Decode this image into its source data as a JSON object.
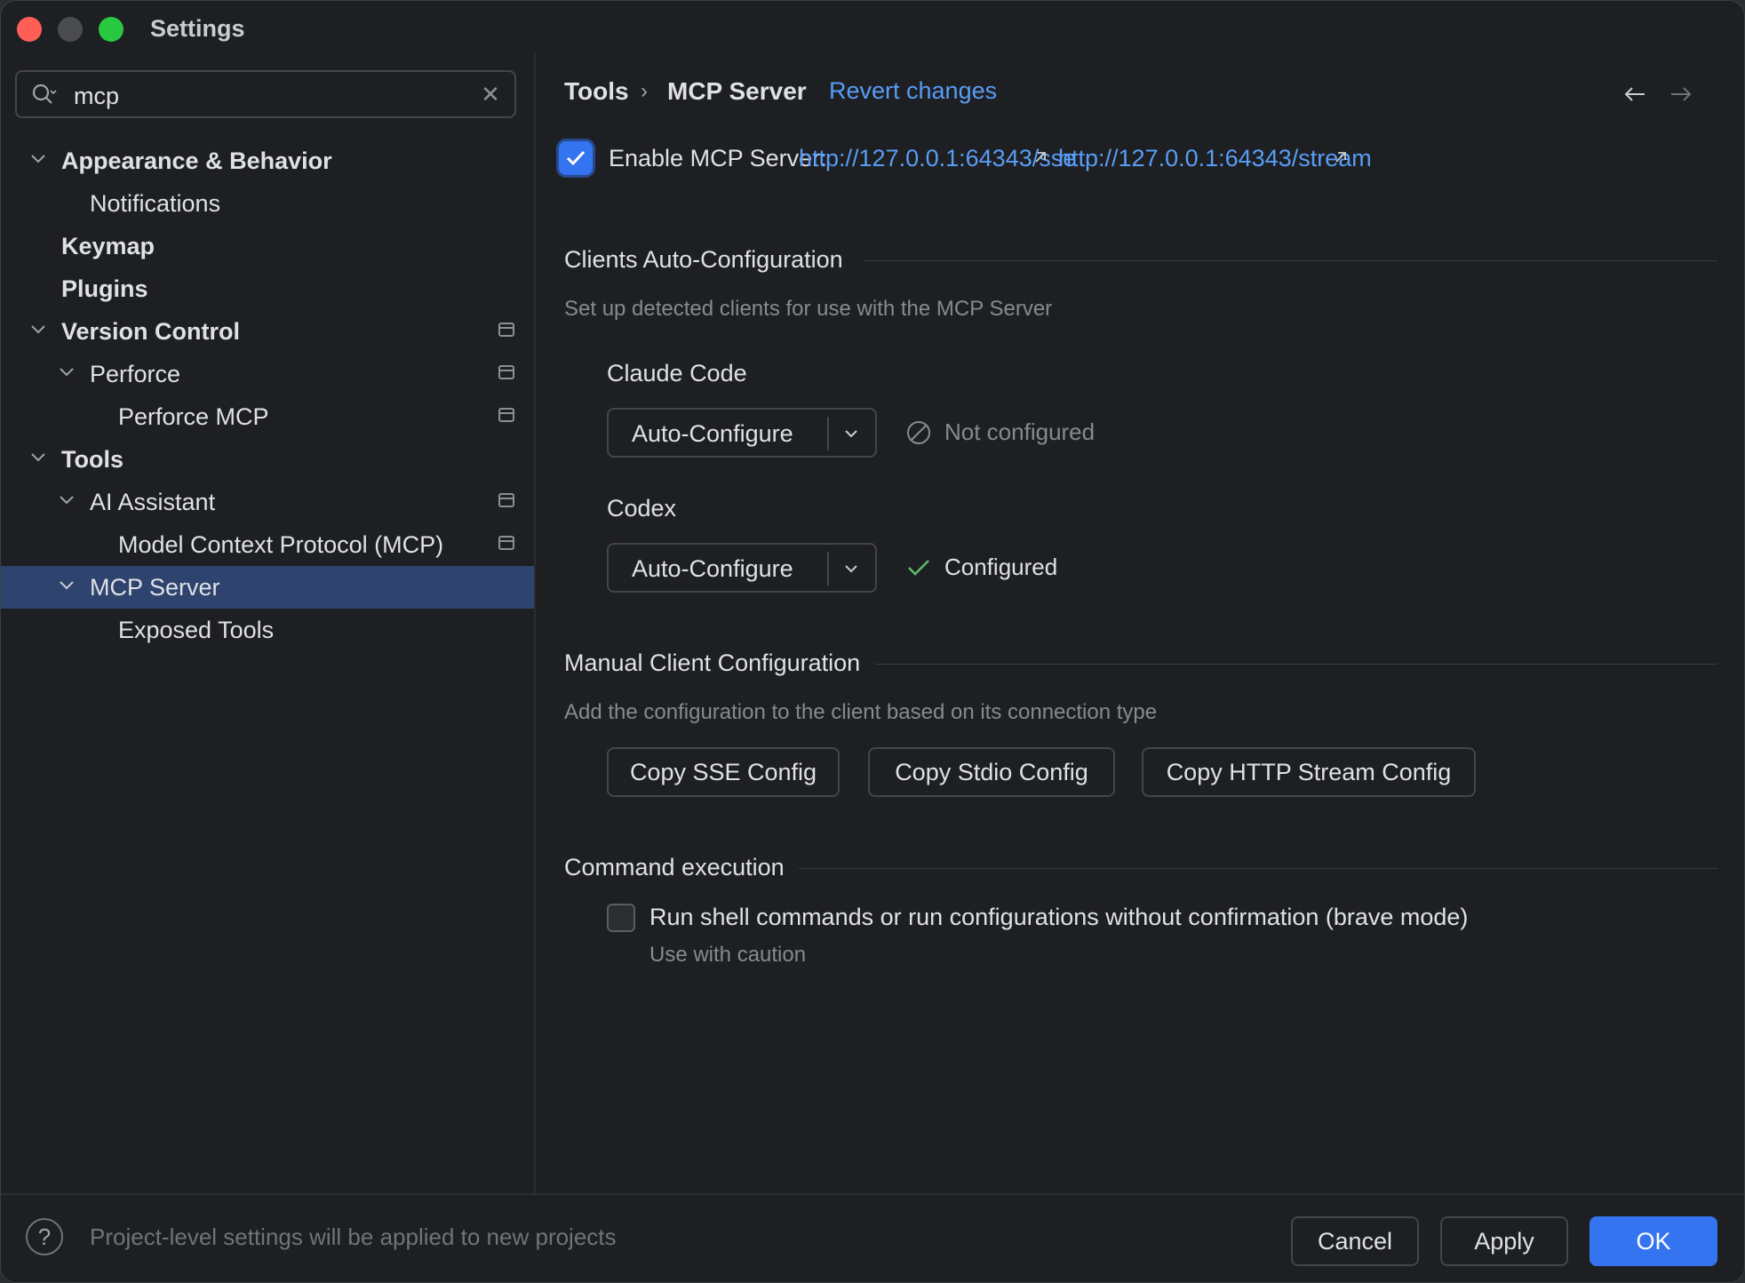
{
  "window": {
    "title": "Settings"
  },
  "search": {
    "value": "mcp"
  },
  "tree": [
    {
      "label": "Appearance & Behavior",
      "bold": true
    },
    {
      "label": "Notifications",
      "bold": false
    },
    {
      "label": "Keymap",
      "bold": true
    },
    {
      "label": "Plugins",
      "bold": true
    },
    {
      "label": "Version Control",
      "bold": true
    },
    {
      "label": "Perforce",
      "bold": false
    },
    {
      "label": "Perforce MCP",
      "bold": false
    },
    {
      "label": "Tools",
      "bold": true
    },
    {
      "label": "AI Assistant",
      "bold": false
    },
    {
      "label": "Model Context Protocol (MCP)",
      "bold": false
    },
    {
      "label": "MCP Server",
      "bold": false,
      "selected": true
    },
    {
      "label": "Exposed Tools",
      "bold": false
    }
  ],
  "header": {
    "crumb1": "Tools",
    "separator": "›",
    "crumb2": "MCP Server",
    "revert": "Revert changes"
  },
  "enable": {
    "label": "Enable MCP Server:",
    "checked": true,
    "sse_url": "http://127.0.0.1:64343/sse",
    "stream_url": "http://127.0.0.1:64343/stream"
  },
  "auto_config": {
    "title": "Clients Auto-Configuration",
    "hint": "Set up detected clients for use with the MCP Server",
    "clients": [
      {
        "name": "Claude Code",
        "action": "Auto-Configure",
        "status": "Not configured",
        "status_color": "#868a91"
      },
      {
        "name": "Codex",
        "action": "Auto-Configure",
        "status": "Configured",
        "status_color": "#dfe1e5"
      }
    ]
  },
  "manual_config": {
    "title": "Manual Client Configuration",
    "hint": "Add the configuration to the client based on its connection type",
    "buttons": [
      "Copy SSE Config",
      "Copy Stdio Config",
      "Copy HTTP Stream Config"
    ]
  },
  "command_exec": {
    "title": "Command execution",
    "checkbox_label": "Run shell commands or run configurations without confirmation (brave mode)",
    "checkbox_hint": "Use with caution",
    "checked": false
  },
  "footer": {
    "help": "?",
    "note": "Project-level settings will be applied to new projects",
    "cancel": "Cancel",
    "apply": "Apply",
    "ok": "OK"
  },
  "colors": {
    "accent": "#3574f0",
    "link": "#589df6",
    "selection": "#2e436e",
    "success": "#5fb865"
  }
}
